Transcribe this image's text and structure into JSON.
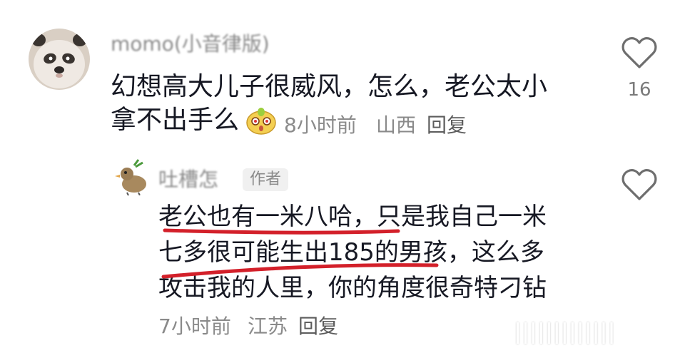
{
  "comment": {
    "username": "momo(小音律版)",
    "text_line1": "幻想高大儿子很威风，怎么，老公太小",
    "text_line2": "拿不出手么",
    "emoji": "hamster-surprised-emoji",
    "time": "8小时前",
    "location": "山西",
    "reply_label": "回复",
    "like_count": "16"
  },
  "reply": {
    "username": "吐槽怎",
    "badge": "作者",
    "text_line1": "老公也有一米八哈，只是我自己一米",
    "text_line2": "七多很可能生出185的男孩，这么多",
    "text_line3": "攻击我的人里，你的角度很奇特刁钻",
    "time": "7小时前",
    "location": "江苏",
    "reply_label": "回复",
    "underline_color": "#d3202a"
  },
  "icons": {
    "like": "heart-outline-icon"
  },
  "watermark": {
    "text": "|||||||||||||"
  }
}
